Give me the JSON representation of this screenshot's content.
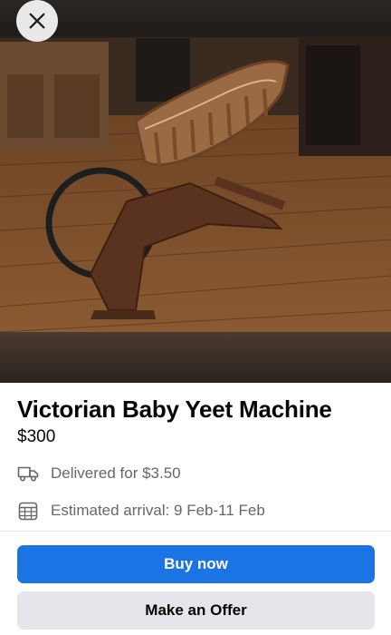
{
  "listing": {
    "title": "Victorian Baby Yeet Machine",
    "price": "$300",
    "delivery_text": "Delivered for $3.50",
    "arrival_text": "Estimated arrival: 9 Feb-11 Feb"
  },
  "actions": {
    "buy_label": "Buy now",
    "offer_label": "Make an Offer"
  },
  "icons": {
    "close": "close-icon",
    "delivery": "truck-icon",
    "arrival": "calendar-icon"
  },
  "colors": {
    "primary": "#1b74e4",
    "secondary_button": "#e4e6eb",
    "muted_text": "#65676b"
  }
}
